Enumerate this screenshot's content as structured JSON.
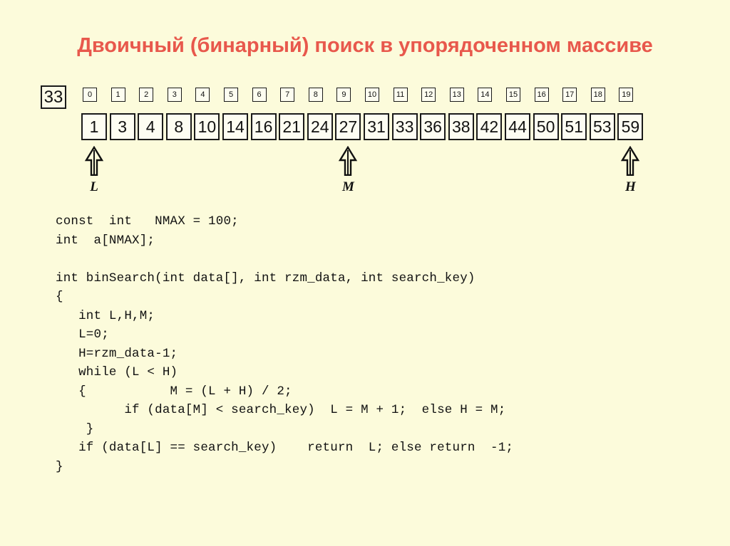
{
  "title": "Двоичный (бинарный) поиск в упорядоченном массиве",
  "colors": {
    "background": "#fcfbdb",
    "title": "#e8584c",
    "box_border": "#1a1a1a",
    "box_fill": "#fdfdf2",
    "text": "#111111"
  },
  "diagram": {
    "search_key": "33",
    "indices": [
      "0",
      "1",
      "2",
      "3",
      "4",
      "5",
      "6",
      "7",
      "8",
      "9",
      "10",
      "11",
      "12",
      "13",
      "14",
      "15",
      "16",
      "17",
      "18",
      "19"
    ],
    "values": [
      "1",
      "3",
      "4",
      "8",
      "10",
      "14",
      "16",
      "21",
      "24",
      "27",
      "31",
      "33",
      "36",
      "38",
      "42",
      "44",
      "50",
      "51",
      "53",
      "59"
    ],
    "pointers": [
      {
        "label": "L",
        "index": 0
      },
      {
        "label": "M",
        "index": 9
      },
      {
        "label": "H",
        "index": 19
      }
    ]
  },
  "code": {
    "lines": [
      "const  int   NMAX = 100;",
      "int  a[NMAX];",
      "",
      "int binSearch(int data[], int rzm_data, int search_key)",
      "{",
      "   int L,H,M;",
      "   L=0;",
      "   H=rzm_data-1;",
      "   while (L < H)",
      "   {           M = (L + H) / 2;",
      "         if (data[M] < search_key)  L = M + 1;  else H = M;",
      "    }",
      "   if (data[L] == search_key)    return  L; else return  -1;",
      "}"
    ]
  }
}
